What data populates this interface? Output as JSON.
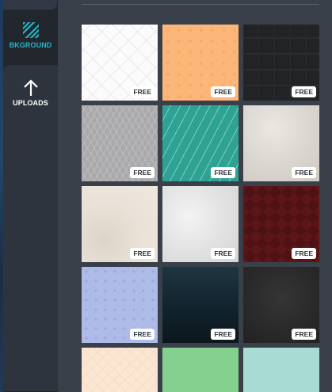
{
  "sidebar": {
    "items": [
      {
        "label": "BKGROUND",
        "icon": "background-stripes-icon",
        "active": true,
        "color": "#21b6c9"
      },
      {
        "label": "UPLOADS",
        "icon": "upload-arrow-icon",
        "active": false,
        "color": "#ffffff"
      }
    ]
  },
  "backgrounds": {
    "tiles": [
      {
        "name": "white-diamond-pattern",
        "badge": "FREE"
      },
      {
        "name": "orange-dots-pattern",
        "badge": "FREE"
      },
      {
        "name": "dark-charcoal-texture",
        "badge": "FREE"
      },
      {
        "name": "grey-crosshatch-pattern",
        "badge": "FREE"
      },
      {
        "name": "teal-diagonal-stripes",
        "badge": "FREE"
      },
      {
        "name": "beige-paper-texture",
        "badge": "FREE"
      },
      {
        "name": "cream-watercolor-texture",
        "badge": "FREE"
      },
      {
        "name": "light-grey-marble-texture",
        "badge": "FREE"
      },
      {
        "name": "dark-red-chevron-pattern",
        "badge": "FREE"
      },
      {
        "name": "periwinkle-dots-pattern",
        "badge": "FREE"
      },
      {
        "name": "dark-teal-gradient",
        "badge": "FREE"
      },
      {
        "name": "dark-grey-grunge-texture",
        "badge": "FREE"
      },
      {
        "name": "peach-chevron-pattern",
        "badge": ""
      },
      {
        "name": "mint-green-solid",
        "badge": ""
      },
      {
        "name": "pale-aqua-solid",
        "badge": ""
      }
    ]
  }
}
